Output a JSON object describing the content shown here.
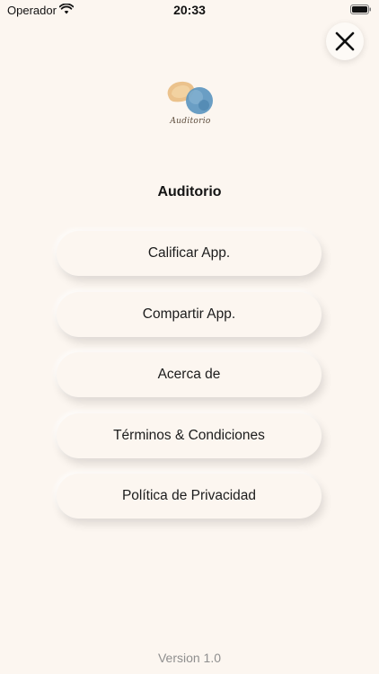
{
  "status_bar": {
    "carrier": "Operador",
    "time": "20:33"
  },
  "logo": {
    "wordmark": "Auditorio"
  },
  "title": "Auditorio",
  "menu": {
    "items": [
      {
        "label": "Calificar App."
      },
      {
        "label": "Compartir App."
      },
      {
        "label": "Acerca de"
      },
      {
        "label": "Términos & Condiciones"
      },
      {
        "label": "Política de Privacidad"
      }
    ]
  },
  "version": "Version 1.0",
  "colors": {
    "background": "#fcf6f0",
    "logo_gold": "#e7b87a",
    "logo_blue": "#5a95bf",
    "text": "#1c1c1c",
    "muted": "#8f8f8f"
  }
}
